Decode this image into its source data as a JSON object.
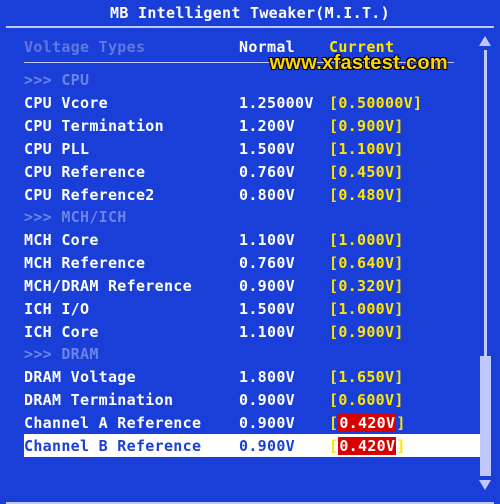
{
  "title": "MB Intelligent Tweaker(M.I.T.)",
  "watermark": "www.xfastest.com",
  "headers": {
    "c0": "Voltage Types",
    "c1": "Normal",
    "c2": "Current"
  },
  "sections": {
    "cpu": ">>> CPU",
    "mch": ">>> MCH/ICH",
    "dram": ">>> DRAM"
  },
  "rows": {
    "cpu_vcore": {
      "name": "CPU Vcore",
      "normal": "1.25000V",
      "current": "0.50000V"
    },
    "cpu_term": {
      "name": "CPU Termination",
      "normal": "1.200V",
      "current": "0.900V"
    },
    "cpu_pll": {
      "name": "CPU PLL",
      "normal": "1.500V",
      "current": "1.100V"
    },
    "cpu_ref": {
      "name": "CPU Reference",
      "normal": "0.760V",
      "current": "0.450V"
    },
    "cpu_ref2": {
      "name": "CPU Reference2",
      "normal": "0.800V",
      "current": "0.480V"
    },
    "mch_core": {
      "name": "MCH Core",
      "normal": "1.100V",
      "current": "1.000V"
    },
    "mch_ref": {
      "name": "MCH Reference",
      "normal": "0.760V",
      "current": "0.640V"
    },
    "mch_dram_ref": {
      "name": "MCH/DRAM Reference",
      "normal": "0.900V",
      "current": "0.320V"
    },
    "ich_io": {
      "name": "ICH I/O",
      "normal": "1.500V",
      "current": "1.000V"
    },
    "ich_core": {
      "name": "ICH Core",
      "normal": "1.100V",
      "current": "0.900V"
    },
    "dram_volt": {
      "name": "DRAM Voltage",
      "normal": "1.800V",
      "current": "1.650V"
    },
    "dram_term": {
      "name": "DRAM Termination",
      "normal": "0.900V",
      "current": "0.600V"
    },
    "ch_a_ref": {
      "name": "Channel A Reference",
      "normal": "0.900V",
      "current": "0.420V"
    },
    "ch_b_ref": {
      "name": "Channel B Reference",
      "normal": "0.900V",
      "current": "0.420V"
    }
  }
}
